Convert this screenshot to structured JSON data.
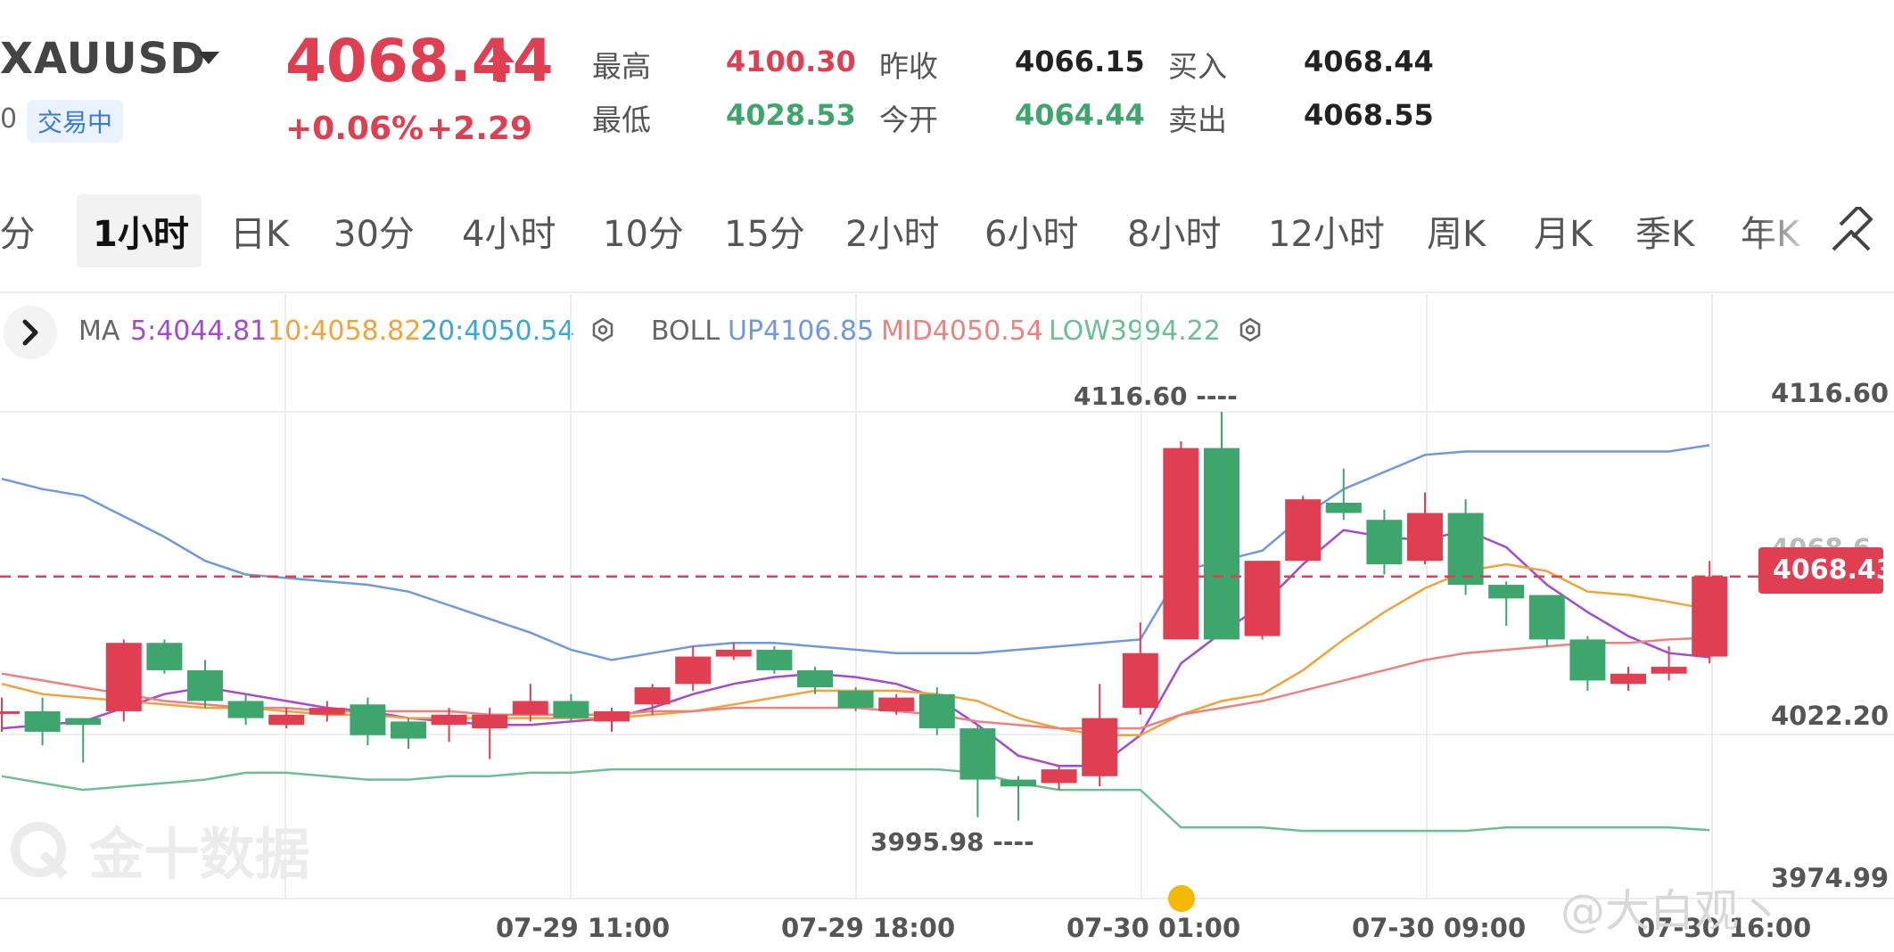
{
  "header": {
    "symbol": "XAUUSD",
    "code_fragment": "0",
    "status": "交易中",
    "price": "4068.44",
    "change_pct": "+0.06%",
    "change": "+2.29",
    "quote": [
      {
        "label": "最高",
        "value": "4100.30",
        "tone": "red"
      },
      {
        "label": "最低",
        "value": "4028.53",
        "tone": "grn"
      },
      {
        "label": "昨收",
        "value": "4066.15",
        "tone": "dark"
      },
      {
        "label": "今开",
        "value": "4064.44",
        "tone": "grn"
      },
      {
        "label": "买入",
        "value": "4068.44",
        "tone": "dark"
      },
      {
        "label": "卖出",
        "value": "4068.55",
        "tone": "dark"
      }
    ]
  },
  "tabs": {
    "items": [
      "5分",
      "1小时",
      "日K",
      "30分",
      "4小时",
      "10分",
      "15分",
      "2小时",
      "6小时",
      "8小时",
      "12小时",
      "周K",
      "月K",
      "季K",
      "年K"
    ],
    "active": "1小时"
  },
  "legend": {
    "ma_title": "MA",
    "ma5": "5:4044.81",
    "ma10": "10:4058.82",
    "ma20": "20:4050.54",
    "boll_title": "BOLL",
    "up": "UP4106.85",
    "mid": "MID4050.54",
    "low": "LOW3994.22"
  },
  "colors": {
    "up": "#e03e51",
    "down": "#3ea66d",
    "ma5": "#a549d2",
    "ma10": "#f0a33a",
    "ma20": "#3aa6d6",
    "boll_up": "#7098e0",
    "boll_mid": "#ef8080",
    "boll_low": "#6cbf94",
    "label_gray": "#666"
  },
  "icons": {
    "expand": "chevron-right-icon",
    "settings": "gear-icon",
    "draw": "draw-tool-icon",
    "arrow": "arrow-up-icon"
  },
  "chart_data": {
    "type": "candlestick",
    "y_ticks": [
      4116.6,
      4022.2,
      3974.99
    ],
    "y_ticks_text": [
      "4116.60",
      "4022.20",
      "3974.99"
    ],
    "ylim": [
      3970,
      4125
    ],
    "x_ticks": [
      "07-29 11:00",
      "07-29 18:00",
      "07-30 01:00",
      "07-30 09:00",
      "07-30 16:00"
    ],
    "current_price": 4068.43,
    "current_price_text": "4068.43",
    "partial_label": "4068.6",
    "max_label": "4116.60",
    "min_label": "3995.98",
    "max": 4116.6,
    "min": 3995.98,
    "candles": [
      [
        4029,
        4029,
        4023,
        4033
      ],
      [
        4029,
        4023,
        4019,
        4033
      ],
      [
        4027,
        4025,
        4014,
        4027
      ],
      [
        4029,
        4049,
        4026,
        4050
      ],
      [
        4049,
        4041,
        4040,
        4050
      ],
      [
        4041,
        4032,
        4030,
        4044
      ],
      [
        4032,
        4027,
        4025,
        4034
      ],
      [
        4025,
        4028,
        4024,
        4030
      ],
      [
        4028,
        4030,
        4026,
        4032
      ],
      [
        4031,
        4022,
        4019,
        4033
      ],
      [
        4026,
        4021,
        4018,
        4027
      ],
      [
        4025,
        4028,
        4020,
        4030
      ],
      [
        4024,
        4028,
        4015,
        4030
      ],
      [
        4028,
        4032,
        4026,
        4037
      ],
      [
        4032,
        4027,
        4026,
        4034
      ],
      [
        4026,
        4029,
        4023,
        4030
      ],
      [
        4031,
        4036,
        4028,
        4037
      ],
      [
        4037,
        4045,
        4035,
        4048
      ],
      [
        4045,
        4047,
        4044,
        4049
      ],
      [
        4047,
        4041,
        4040,
        4048
      ],
      [
        4041,
        4036,
        4034,
        4042
      ],
      [
        4035,
        4030,
        4029,
        4036
      ],
      [
        4029,
        4033,
        4028,
        4034
      ],
      [
        4034,
        4024,
        4022,
        4036
      ],
      [
        4024,
        4009,
        3998,
        4025
      ],
      [
        4009,
        4007,
        3997,
        4010
      ],
      [
        4008,
        4012,
        4006,
        4013
      ],
      [
        4010,
        4027,
        4007,
        4037
      ],
      [
        4030,
        4046,
        4028,
        4055
      ],
      [
        4050,
        4106,
        4050,
        4108
      ],
      [
        4106,
        4050,
        4050,
        4116.6
      ],
      [
        4051,
        4073,
        4050,
        4073
      ],
      [
        4073,
        4091,
        4090,
        4092
      ],
      [
        4090,
        4087,
        4085,
        4100
      ],
      [
        4085,
        4072,
        4069,
        4088
      ],
      [
        4073,
        4087,
        4072,
        4093
      ],
      [
        4087,
        4066,
        4063,
        4091
      ],
      [
        4066,
        4062,
        4054,
        4067
      ],
      [
        4063,
        4050,
        4048,
        4063
      ],
      [
        4050,
        4038,
        4035,
        4051
      ],
      [
        4037,
        4040,
        4035,
        4042
      ],
      [
        4040,
        4042,
        4038,
        4048
      ],
      [
        4045,
        4068.43,
        4043,
        4073
      ]
    ],
    "series": [
      {
        "name": "MA5",
        "values": [
          4024,
          4025,
          4026,
          4030,
          4034,
          4036,
          4034,
          4032,
          4030,
          4029,
          4027,
          4026,
          4025,
          4025,
          4026,
          4027,
          4030,
          4034,
          4037,
          4039,
          4040,
          4039,
          4037,
          4033,
          4025,
          4016,
          4013,
          4013,
          4022,
          4043,
          4052,
          4060,
          4072,
          4082,
          4080,
          4079,
          4082,
          4077,
          4066,
          4058,
          4051,
          4046,
          4044.81
        ]
      },
      {
        "name": "MA10",
        "values": [
          4037,
          4034,
          4033,
          4032,
          4031,
          4030,
          4030,
          4029,
          4028,
          4028,
          4027,
          4027,
          4027,
          4027,
          4027,
          4027,
          4028,
          4029,
          4031,
          4033,
          4035,
          4035,
          4035,
          4034,
          4032,
          4027,
          4024,
          4022,
          4022,
          4028,
          4032,
          4034,
          4041,
          4050,
          4058,
          4065,
          4070,
          4072,
          4070,
          4064,
          4063,
          4061,
          4058.82
        ]
      },
      {
        "name": "BOLL-UP",
        "values": [
          4097,
          4094,
          4092,
          4086,
          4080,
          4073,
          4069,
          4068,
          4067,
          4066,
          4064,
          4060,
          4056,
          4052,
          4047,
          4044,
          4046,
          4048,
          4049,
          4049,
          4048,
          4047,
          4046,
          4046,
          4046,
          4047,
          4048,
          4049,
          4050,
          4070,
          4073,
          4076,
          4086,
          4094,
          4099,
          4104,
          4105,
          4105,
          4105,
          4105,
          4105,
          4105,
          4106.85
        ]
      },
      {
        "name": "BOLL-MID",
        "values": [
          4040,
          4038,
          4036,
          4034,
          4032,
          4031,
          4030,
          4030,
          4029,
          4029,
          4029,
          4029,
          4028,
          4028,
          4028,
          4028,
          4029,
          4029,
          4030,
          4030,
          4030,
          4030,
          4029,
          4028,
          4026,
          4025,
          4024,
          4024,
          4024,
          4028,
          4030,
          4032,
          4035,
          4038,
          4041,
          4044,
          4046,
          4047,
          4048,
          4049,
          4049,
          4050,
          4050.54
        ]
      },
      {
        "name": "BOLL-LOW",
        "values": [
          4010,
          4008,
          4006,
          4007,
          4008,
          4009,
          4011,
          4011,
          4010,
          4009,
          4009,
          4010,
          4010,
          4011,
          4011,
          4012,
          4012,
          4012,
          4012,
          4012,
          4012,
          4012,
          4012,
          4012,
          4011,
          4008,
          4006,
          4006,
          4006,
          3995,
          3995,
          3995,
          3994,
          3994,
          3994,
          3994,
          3994,
          3995,
          3995,
          3995,
          3995,
          3995,
          3994.22
        ]
      }
    ]
  }
}
